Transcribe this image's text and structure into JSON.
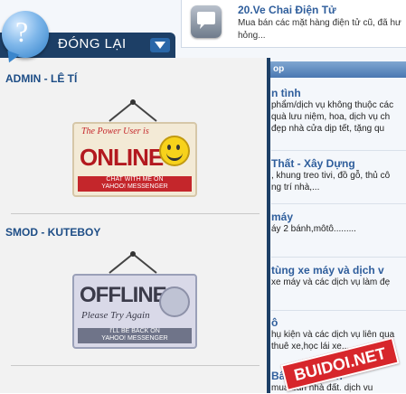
{
  "top_item": {
    "title": "20.Ve Chai Điện Tử",
    "description": "Mua bán các mặt hàng điện tử cũ, đã hư hỏng..."
  },
  "section_bar": "op",
  "bg_items": [
    {
      "title": "n tình",
      "desc1": "phẩm/dịch vụ không thuộc các",
      "desc2": "quà lưu niệm, hoa, dịch vụ ch",
      "desc3": "đẹp nhà cửa dịp tết, tặng qu"
    },
    {
      "title": "Thất - Xây Dựng",
      "desc1": ", khung treo tivi, đồ gỗ, thủ cô",
      "desc2": "ng trí nhà,..."
    },
    {
      "title": "máy",
      "desc1": "áy 2 bánh,môtô........."
    },
    {
      "title": "tùng xe máy và dịch v",
      "desc1": "xe máy và các dịch vụ làm đẹ"
    },
    {
      "title": "ô",
      "desc1": "hụ kiện và các dịch vụ liên qua",
      "desc2": "thuê xe,học lái xe..."
    },
    {
      "title": "Bất Động Sản",
      "desc1": "mua bán nhà đất. dịch vu"
    }
  ],
  "panel": {
    "help_symbol": "?",
    "close_label": "ĐÓNG LẠI",
    "staff": [
      {
        "role_name": "ADMIN - LÊ TÍ",
        "sign": {
          "script": "The Power User is",
          "status": "ONLINE",
          "bar_line1": "CHAT WITH ME ON",
          "bar_line2": "YAHOO! MESSENGER"
        }
      },
      {
        "role_name": "SMOD - KUTEBOY",
        "sign": {
          "status": "OFFLINE",
          "script": "Please Try Again",
          "bar_line1": "I'LL BE BACK ON",
          "bar_line2": "YAHOO! MESSENGER"
        }
      }
    ]
  },
  "watermark": "BUIDOI.NET",
  "colors": {
    "panel_navy": "#1d3f66",
    "link_blue": "#2f5e9c",
    "online_red": "#c4262b",
    "watermark_red": "#d7262b"
  },
  "icons": [
    "help-icon",
    "chat-bubble-icon",
    "chevron-down-icon",
    "smiley-icon",
    "offline-face-icon"
  ]
}
